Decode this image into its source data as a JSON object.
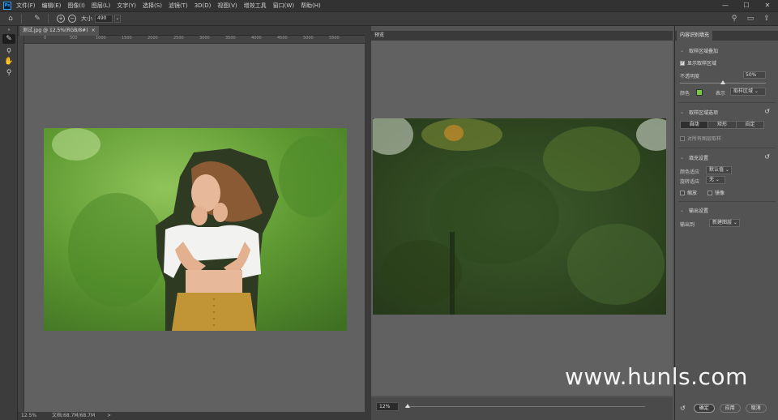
{
  "app": {
    "logo": "Ps"
  },
  "menu": [
    "文件(F)",
    "编辑(E)",
    "图像(I)",
    "图层(L)",
    "文字(Y)",
    "选择(S)",
    "滤镜(T)",
    "3D(D)",
    "视图(V)",
    "增效工具",
    "窗口(W)",
    "帮助(H)"
  ],
  "window_controls": {
    "minimize": "—",
    "maximize": "☐",
    "close": "✕"
  },
  "options": {
    "size_label": "大小",
    "size_value": "490"
  },
  "document": {
    "tab_title": "测试.jpg @ 12.5%(RGB/8#)",
    "tab_close": "×"
  },
  "ruler_ticks": [
    "0",
    "500",
    "1000",
    "1500",
    "2000",
    "2500",
    "3000",
    "3500",
    "4000",
    "4500",
    "5000",
    "5500"
  ],
  "status": {
    "zoom": "12.5%",
    "doc_info": "文档:68.7M/68.7M",
    "arrow": ">"
  },
  "preview": {
    "tab": "预览",
    "zoom": "12%"
  },
  "panel": {
    "tab": "内容识别填充",
    "sampling_overlay": {
      "title": "取样区域叠加",
      "show_label": "显示取样区域",
      "show_checked": true,
      "opacity_label": "不透明度",
      "opacity_value": "50%",
      "opacity": 50,
      "color_label": "颜色",
      "color": "#7ac943",
      "indicates_label": "表示",
      "indicates_value": "取样区域"
    },
    "sampling_options": {
      "title": "取样区域选项",
      "modes": [
        "自动",
        "矩形",
        "自定"
      ],
      "selected": "自动",
      "sample_all_layers": "对所有图层取样"
    },
    "fill_settings": {
      "title": "填充设置",
      "color_adapt_label": "颜色适应",
      "color_adapt_value": "默认值",
      "rotation_label": "旋转适应",
      "rotation_value": "无",
      "scale": "缩放",
      "mirror": "镜像"
    },
    "output": {
      "title": "输出设置",
      "output_to_label": "输出到",
      "output_to_value": "新建图层"
    },
    "buttons": {
      "reset": "↺",
      "ok": "确定",
      "apply": "应用",
      "cancel": "取消"
    }
  },
  "watermark": "www.hunls.com"
}
